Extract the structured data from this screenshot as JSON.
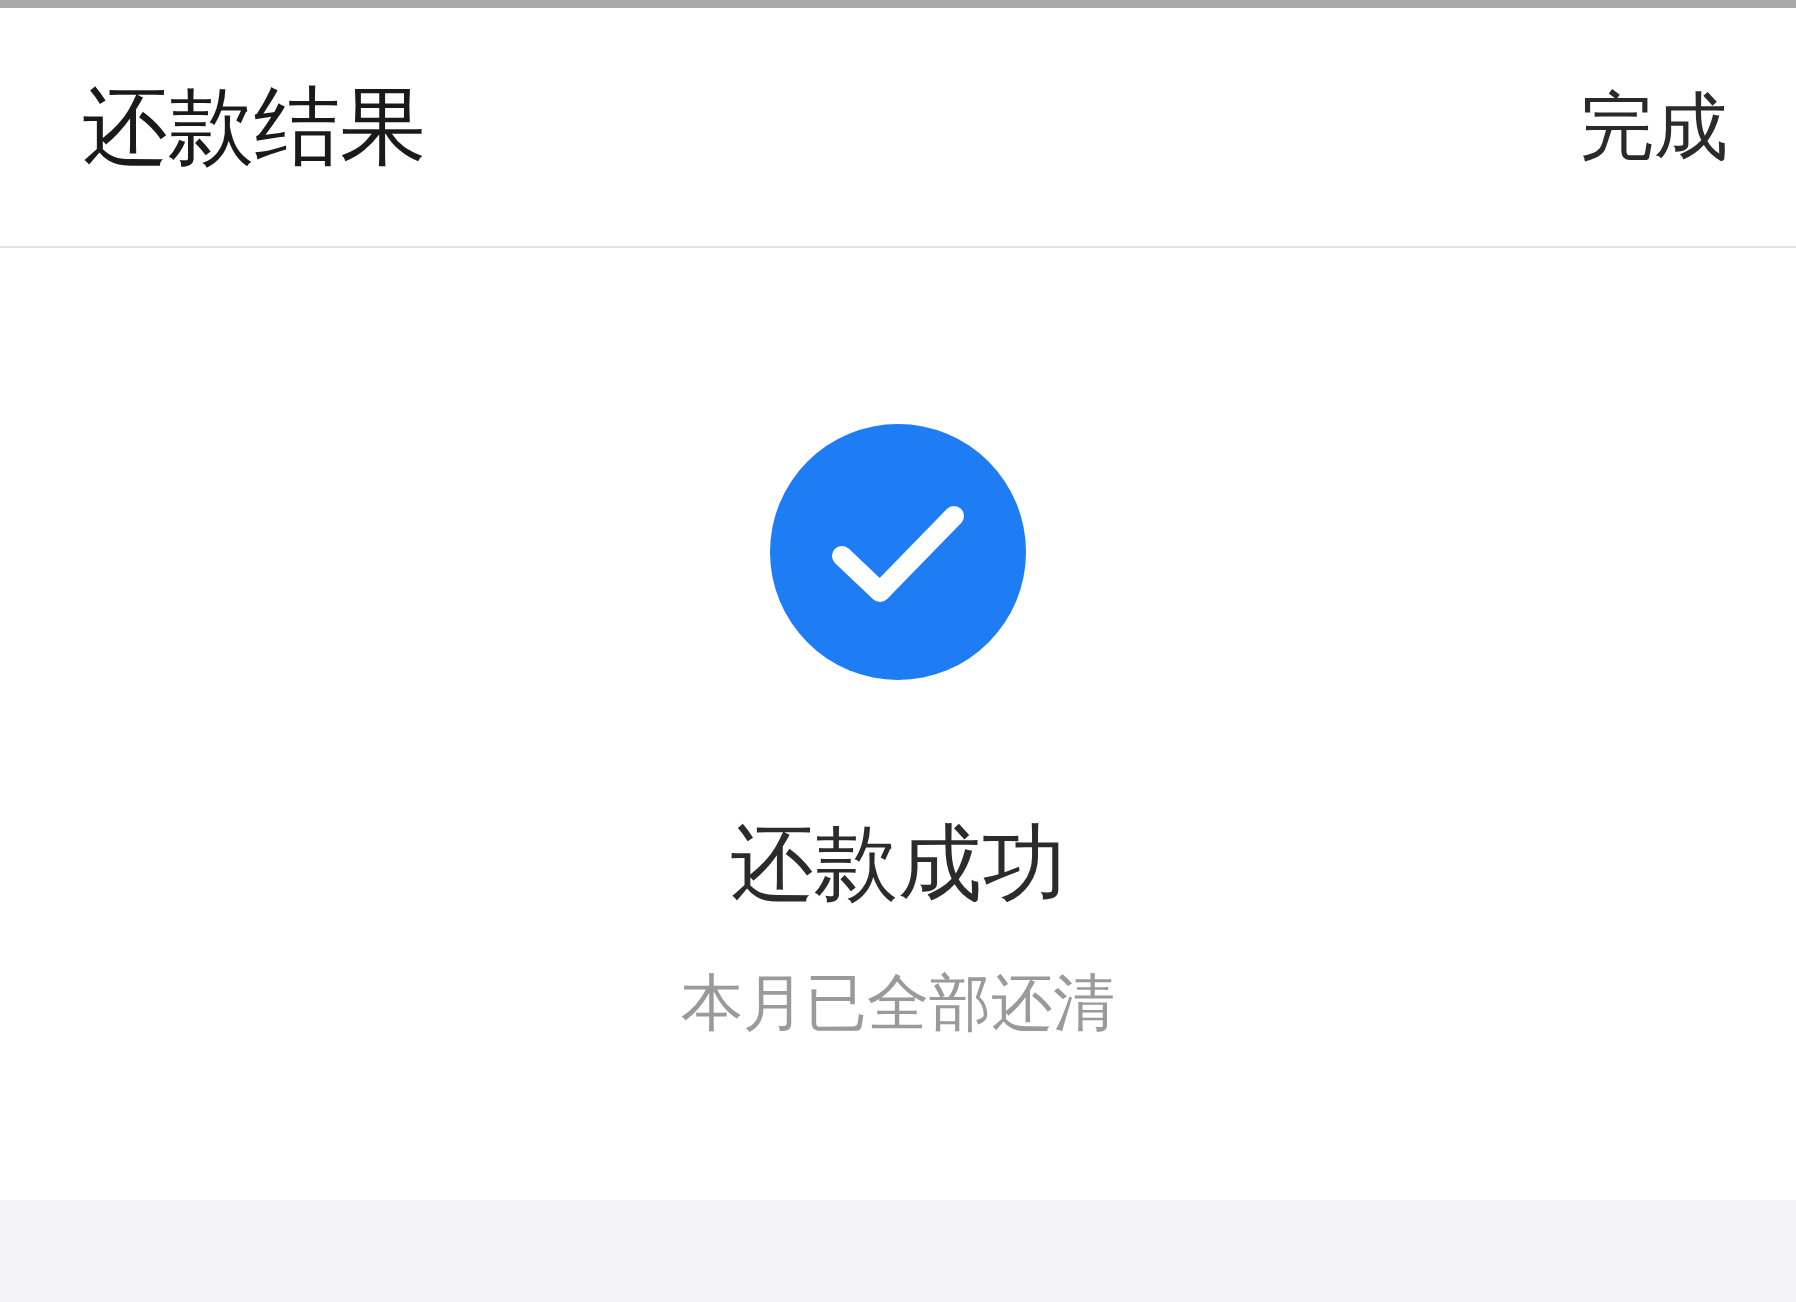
{
  "header": {
    "title": "还款结果",
    "action": "完成"
  },
  "result": {
    "title": "还款成功",
    "message": "本月已全部还清"
  }
}
